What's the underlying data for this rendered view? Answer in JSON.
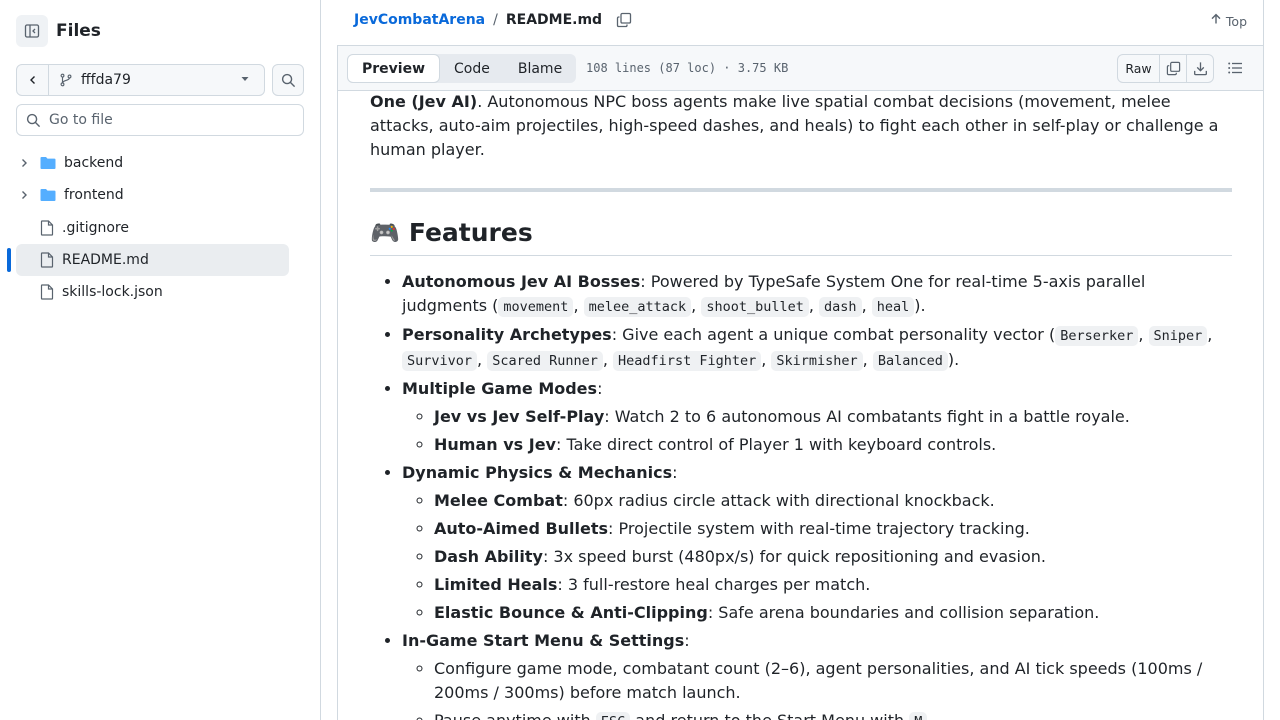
{
  "sidebar": {
    "title": "Files",
    "branch": "fffda79",
    "search_placeholder": "Go to file",
    "items": [
      {
        "label": "backend",
        "type": "folder"
      },
      {
        "label": "frontend",
        "type": "folder"
      },
      {
        "label": ".gitignore",
        "type": "file"
      },
      {
        "label": "README.md",
        "type": "file",
        "active": true
      },
      {
        "label": "skills-lock.json",
        "type": "file"
      }
    ]
  },
  "header": {
    "repo": "JevCombatArena",
    "sep": "/",
    "file": "README.md",
    "top_label": "Top"
  },
  "filebar": {
    "tabs": [
      "Preview",
      "Code",
      "Blame"
    ],
    "meta": "108 lines (87 loc) · 3.75 KB",
    "raw_label": "Raw"
  },
  "content": {
    "intro_bold": "One (Jev AI)",
    "intro_rest": ". Autonomous NPC boss agents make live spatial combat decisions (movement, melee attacks, auto-aim projectiles, high-speed dashes, and heals) to fight each other in self-play or challenge a human player.",
    "features_emoji": "🎮",
    "features_title": "Features",
    "f1_bold": "Autonomous Jev AI Bosses",
    "f1_text": ": Powered by TypeSafe System One for real-time 5-axis parallel judgments (",
    "f1_codes": [
      "movement",
      "melee_attack",
      "shoot_bullet",
      "dash",
      "heal"
    ],
    "f1_end": ").",
    "f2_bold": "Personality Archetypes",
    "f2_text": ": Give each agent a unique combat personality vector (",
    "f2_codes": [
      "Berserker",
      "Sniper",
      "Survivor",
      "Scared Runner",
      "Headfirst Fighter",
      "Skirmisher",
      "Balanced"
    ],
    "f2_end": ").",
    "f3_bold": "Multiple Game Modes",
    "f3_sub": [
      {
        "bold": "Jev vs Jev Self-Play",
        "text": ": Watch 2 to 6 autonomous AI combatants fight in a battle royale."
      },
      {
        "bold": "Human vs Jev",
        "text": ": Take direct control of Player 1 with keyboard controls."
      }
    ],
    "f4_bold": "Dynamic Physics & Mechanics",
    "f4_sub": [
      {
        "bold": "Melee Combat",
        "text": ": 60px radius circle attack with directional knockback."
      },
      {
        "bold": "Auto-Aimed Bullets",
        "text": ": Projectile system with real-time trajectory tracking."
      },
      {
        "bold": "Dash Ability",
        "text": ": 3x speed burst (480px/s) for quick repositioning and evasion."
      },
      {
        "bold": "Limited Heals",
        "text": ": 3 full-restore heal charges per match."
      },
      {
        "bold": "Elastic Bounce & Anti-Clipping",
        "text": ": Safe arena boundaries and collision separation."
      }
    ],
    "f5_bold": "In-Game Start Menu & Settings",
    "f5_sub1": "Configure game mode, combatant count (2–6), agent personalities, and AI tick speeds (100ms / 200ms / 300ms) before match launch.",
    "f5_sub2_a": "Pause anytime with ",
    "f5_sub2_code1": "ESC",
    "f5_sub2_b": " and return to the Start Menu with ",
    "f5_sub2_code2": "M",
    "f5_sub2_c": ".",
    "colon": ":",
    "comma": ", "
  },
  "colors": {
    "link": "#0969da",
    "accent": "#0969da",
    "folder": "#54aeff"
  }
}
